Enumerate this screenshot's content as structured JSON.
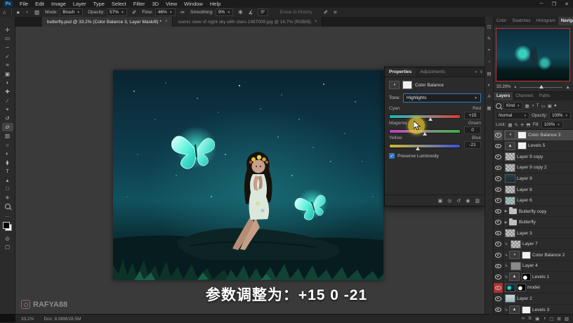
{
  "menubar": {
    "logo": "Ps",
    "items": [
      "File",
      "Edit",
      "Image",
      "Layer",
      "Type",
      "Select",
      "Filter",
      "3D",
      "View",
      "Window",
      "Help"
    ],
    "window_controls": {
      "minimize": "─",
      "maximize": "❐",
      "close": "✕"
    }
  },
  "options_bar": {
    "mode_label": "Mode:",
    "mode_value": "Brush",
    "opacity_label": "Opacity:",
    "opacity_value": "57%",
    "flow_label": "Flow:",
    "flow_value": "46%",
    "smoothing_label": "Smoothing:",
    "smoothing_value": "9%",
    "angle_value": "0°",
    "erase_history_label": "Erase to History"
  },
  "doc_tabs": [
    {
      "label": "butterfly.psd @ 33.2% (Color Balance 3, Layer Mask/8) *",
      "close": "×"
    },
    {
      "label": "scenic view of night sky with stars-1487009.jpg @ 16.7% (RGB/8)",
      "close": "×"
    }
  ],
  "properties_panel": {
    "tabs": [
      "Properties",
      "Adjustments"
    ],
    "title": "Color Balance",
    "tone_label": "Tone:",
    "tone_value": "Highlights",
    "sliders": [
      {
        "left_label": "Cyan",
        "right_label": "Red",
        "value": "+15",
        "percent": 57.5
      },
      {
        "left_label": "Magenta",
        "right_label": "Green",
        "value": "0",
        "percent": 50
      },
      {
        "left_label": "Yellow",
        "right_label": "Blue",
        "value": "-21",
        "percent": 40
      }
    ],
    "preserve_label": "Preserve Luminosity"
  },
  "navigator_panel": {
    "tabs": [
      "Color",
      "Swatches",
      "Histogram",
      "Navigator"
    ],
    "zoom_value": "33.29%"
  },
  "layers_panel": {
    "tabs": [
      "Layers",
      "Channels",
      "Paths"
    ],
    "filter_label": "Kind",
    "blend_mode": "Normal",
    "opacity_label": "Opacity:",
    "opacity_value": "100%",
    "lock_label": "Lock:",
    "fill_label": "Fill:",
    "fill_value": "100%",
    "rows": [
      {
        "name": "Color Balance 3"
      },
      {
        "name": "Levels 5"
      },
      {
        "name": "Layer 9 copy"
      },
      {
        "name": "Layer 9 copy 2"
      },
      {
        "name": "Layer 9"
      },
      {
        "name": "Layer 8"
      },
      {
        "name": "Layer 6"
      },
      {
        "name": "Butterfly copy"
      },
      {
        "name": "Butterfly"
      },
      {
        "name": "Layer 3"
      },
      {
        "name": "Layer 7"
      },
      {
        "name": "Color Balance 2"
      },
      {
        "name": "Layer 4"
      },
      {
        "name": "Levels 1"
      },
      {
        "name": "model"
      },
      {
        "name": "Layer 2"
      },
      {
        "name": "Levels 3"
      }
    ]
  },
  "status_bar": {
    "zoom": "33.2%",
    "doc_info": "Doc: 8.98M/28.5M"
  },
  "caption": {
    "text": "参数调整为：+15 0 -21"
  },
  "watermark": {
    "text": "RAFYA88"
  },
  "colors": {
    "glow_cyan": "#35e3cf",
    "navigator_border": "#c03434",
    "red_eye_cell": "#b03030",
    "accent_blue": "#2d7ac9"
  }
}
